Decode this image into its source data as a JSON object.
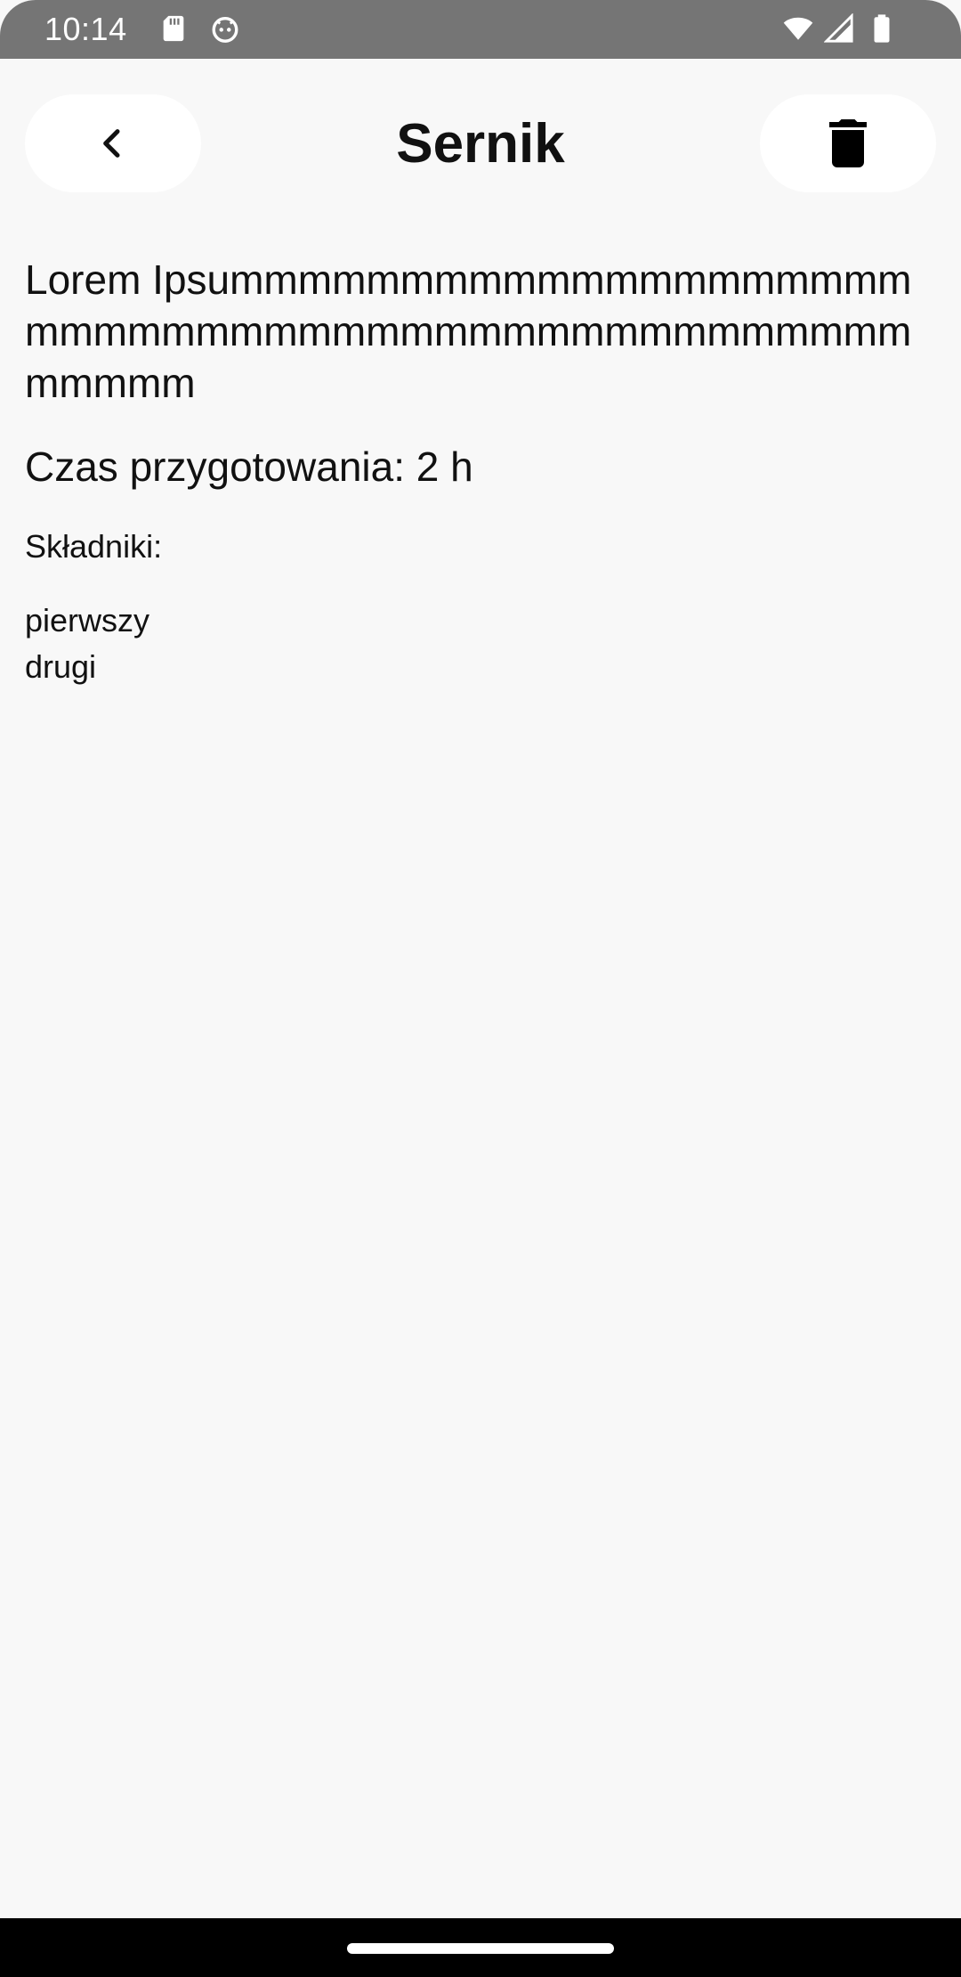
{
  "status_bar": {
    "time": "10:14",
    "left_icons": [
      "sd-card-icon",
      "android-debug-icon"
    ],
    "right_icons": [
      "wifi-icon",
      "cellular-signal-icon",
      "battery-icon"
    ]
  },
  "header": {
    "title": "Sernik",
    "back_icon": "chevron-left-icon",
    "delete_icon": "trash-icon"
  },
  "recipe": {
    "description": "Lorem Ipsummmmmmmmmmmmmmmmmmmmmmmmmmmmmmmmmmmmmmmmmmmmmmmmmmm",
    "prep_time": "Czas przygotowania: 2 h",
    "ingredients_label": "Składniki:",
    "ingredients": [
      "pierwszy",
      "drugi"
    ]
  },
  "colors": {
    "background": "#f8f8f8",
    "status_bar": "#757575",
    "button_bg": "#ffffff",
    "nav_bar": "#000000"
  }
}
